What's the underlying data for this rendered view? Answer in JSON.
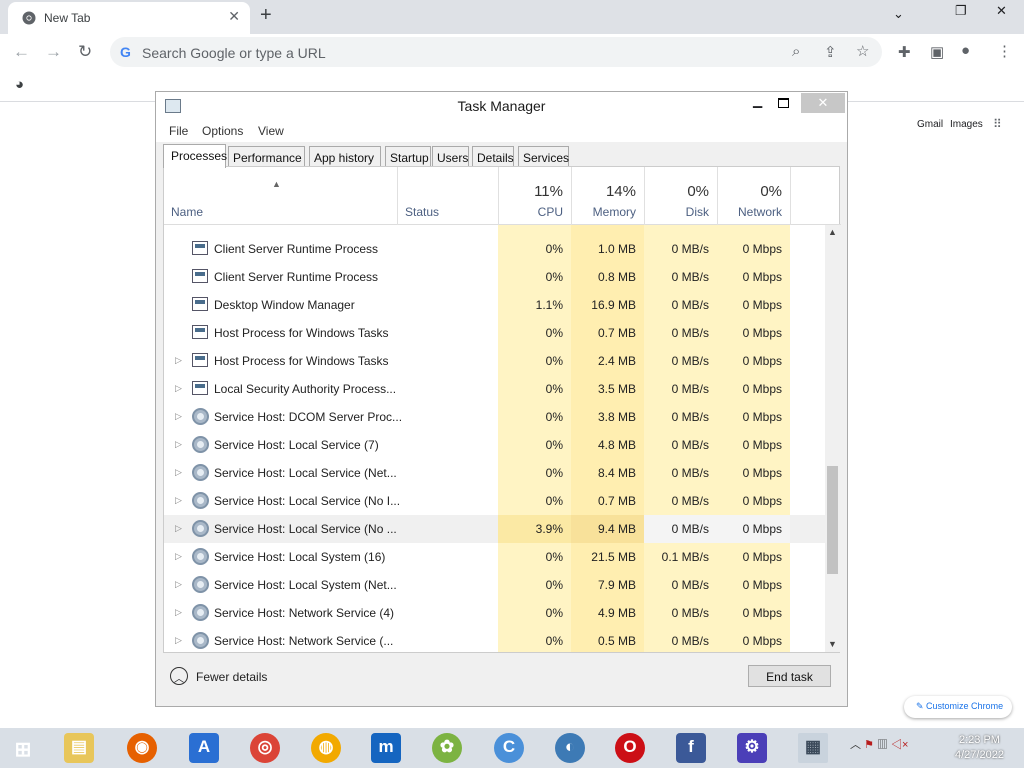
{
  "browser": {
    "tab_title": "New Tab",
    "omnibox_placeholder": "Search Google or type a URL",
    "links": {
      "gmail": "Gmail",
      "images": "Images"
    },
    "customize": "Customize Chrome"
  },
  "task_manager": {
    "title": "Task Manager",
    "menu": [
      "File",
      "Options",
      "View"
    ],
    "tabs": [
      "Processes",
      "Performance",
      "App history",
      "Startup",
      "Users",
      "Details",
      "Services"
    ],
    "active_tab": "Processes",
    "columns": {
      "name": "Name",
      "status": "Status",
      "cpu": {
        "pct": "11%",
        "label": "CPU"
      },
      "memory": {
        "pct": "14%",
        "label": "Memory"
      },
      "disk": {
        "pct": "0%",
        "label": "Disk"
      },
      "network": {
        "pct": "0%",
        "label": "Network"
      }
    },
    "rows": [
      {
        "name": "Client Server Runtime Process",
        "icon": "window-icon",
        "expand": false,
        "cpu": "0%",
        "mem": "1.0 MB",
        "disk": "0 MB/s",
        "net": "0 Mbps"
      },
      {
        "name": "Client Server Runtime Process",
        "icon": "window-icon",
        "expand": false,
        "cpu": "0%",
        "mem": "0.8 MB",
        "disk": "0 MB/s",
        "net": "0 Mbps"
      },
      {
        "name": "Desktop Window Manager",
        "icon": "window-icon",
        "expand": false,
        "cpu": "1.1%",
        "mem": "16.9 MB",
        "disk": "0 MB/s",
        "net": "0 Mbps"
      },
      {
        "name": "Host Process for Windows Tasks",
        "icon": "window-icon",
        "expand": false,
        "cpu": "0%",
        "mem": "0.7 MB",
        "disk": "0 MB/s",
        "net": "0 Mbps"
      },
      {
        "name": "Host Process for Windows Tasks",
        "icon": "window-icon",
        "expand": true,
        "cpu": "0%",
        "mem": "2.4 MB",
        "disk": "0 MB/s",
        "net": "0 Mbps"
      },
      {
        "name": "Local Security Authority Process...",
        "icon": "window-icon",
        "expand": true,
        "cpu": "0%",
        "mem": "3.5 MB",
        "disk": "0 MB/s",
        "net": "0 Mbps"
      },
      {
        "name": "Service Host: DCOM Server Proc...",
        "icon": "gear-icon",
        "expand": true,
        "cpu": "0%",
        "mem": "3.8 MB",
        "disk": "0 MB/s",
        "net": "0 Mbps"
      },
      {
        "name": "Service Host: Local Service (7)",
        "icon": "gear-icon",
        "expand": true,
        "cpu": "0%",
        "mem": "4.8 MB",
        "disk": "0 MB/s",
        "net": "0 Mbps"
      },
      {
        "name": "Service Host: Local Service (Net...",
        "icon": "gear-icon",
        "expand": true,
        "cpu": "0%",
        "mem": "8.4 MB",
        "disk": "0 MB/s",
        "net": "0 Mbps"
      },
      {
        "name": "Service Host: Local Service (No I...",
        "icon": "gear-icon",
        "expand": true,
        "cpu": "0%",
        "mem": "0.7 MB",
        "disk": "0 MB/s",
        "net": "0 Mbps"
      },
      {
        "name": "Service Host: Local Service (No ...",
        "icon": "gear-icon",
        "expand": true,
        "cpu": "3.9%",
        "mem": "9.4 MB",
        "disk": "0 MB/s",
        "net": "0 Mbps",
        "selected": true
      },
      {
        "name": "Service Host: Local System (16)",
        "icon": "gear-icon",
        "expand": true,
        "cpu": "0%",
        "mem": "21.5 MB",
        "disk": "0.1 MB/s",
        "net": "0 Mbps"
      },
      {
        "name": "Service Host: Local System (Net...",
        "icon": "gear-icon",
        "expand": true,
        "cpu": "0%",
        "mem": "7.9 MB",
        "disk": "0 MB/s",
        "net": "0 Mbps"
      },
      {
        "name": "Service Host: Network Service (4)",
        "icon": "gear-icon",
        "expand": true,
        "cpu": "0%",
        "mem": "4.9 MB",
        "disk": "0 MB/s",
        "net": "0 Mbps"
      },
      {
        "name": "Service Host: Network Service (...",
        "icon": "gear-icon",
        "expand": true,
        "cpu": "0%",
        "mem": "0.5 MB",
        "disk": "0 MB/s",
        "net": "0 Mbps"
      }
    ],
    "fewer_details": "Fewer details",
    "end_task": "End task"
  },
  "taskbar": {
    "clock_time": "2:23 PM",
    "clock_date": "4/27/2022"
  }
}
